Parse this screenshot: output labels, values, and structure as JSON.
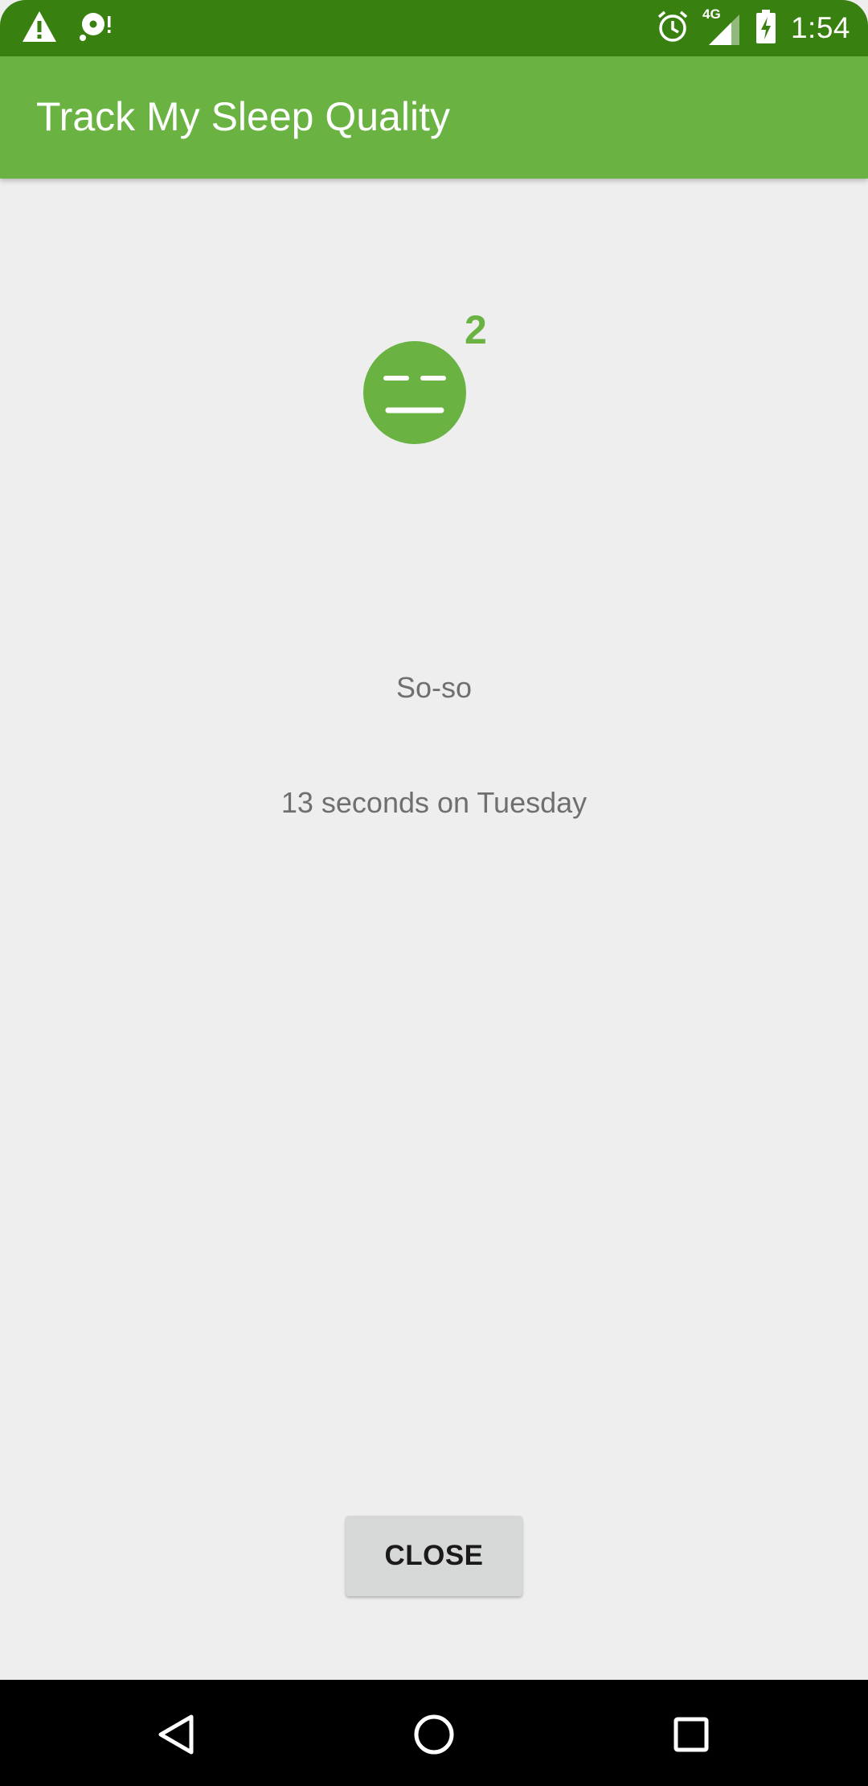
{
  "status_bar": {
    "time": "1:54",
    "network_label": "4G",
    "icons": [
      "warning-icon",
      "sync-disc-icon",
      "alarm-icon",
      "signal-icon",
      "battery-charging-icon"
    ]
  },
  "app_bar": {
    "title": "Track My Sleep Quality"
  },
  "sleep_detail": {
    "quality_icon": "so-so-face-icon",
    "quality_value": "2",
    "quality_label": "So-so",
    "duration_text": "13 seconds on Tuesday"
  },
  "actions": {
    "close_label": "CLOSE"
  },
  "nav_bar": {
    "icons": [
      "back-icon",
      "home-icon",
      "recents-icon"
    ]
  },
  "colors": {
    "status_bar": "#38800f",
    "app_bar": "#6ab343",
    "accent": "#6ab343",
    "background": "#eeeeee",
    "secondary_text": "#6f6f6f",
    "button": "#d6d7d7",
    "nav_bar": "#000000"
  }
}
